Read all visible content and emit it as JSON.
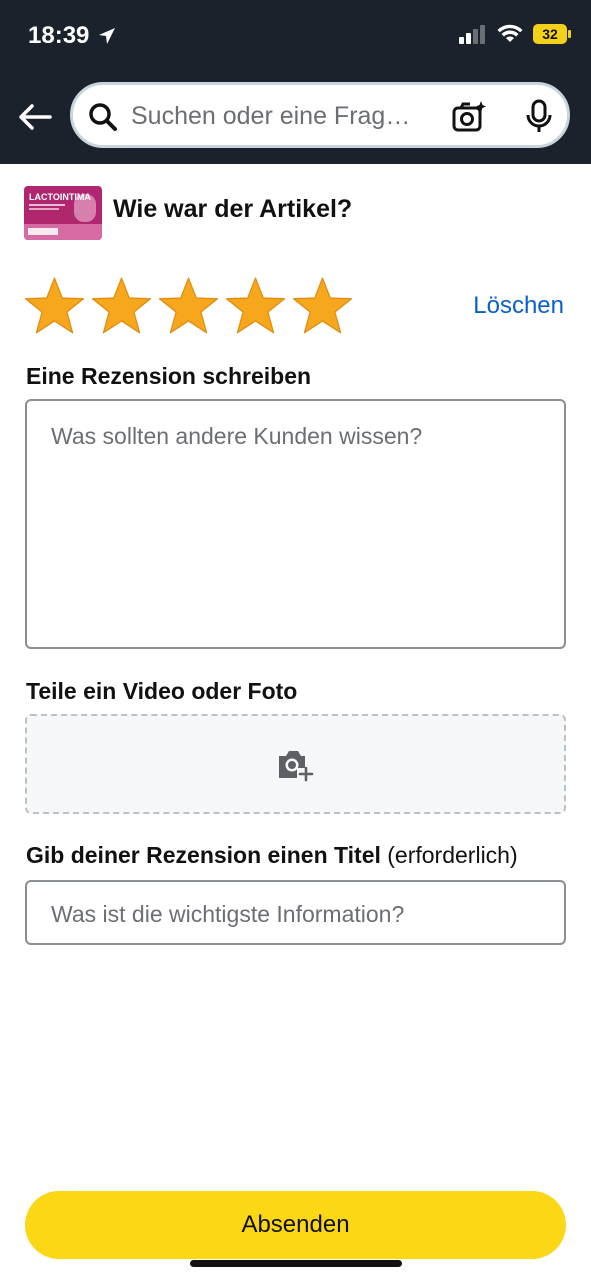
{
  "status_bar": {
    "time": "18:39",
    "battery": "32"
  },
  "search": {
    "placeholder": "Suchen oder eine Frag…"
  },
  "product": {
    "thumb_text": "LACTOINTIMA",
    "question": "Wie war der Artikel?"
  },
  "rating": {
    "value": 5,
    "max": 5,
    "delete_label": "Löschen"
  },
  "review": {
    "label": "Eine Rezension schreiben",
    "placeholder": "Was sollten andere Kunden wissen?"
  },
  "media": {
    "label": "Teile ein Video oder Foto"
  },
  "title": {
    "label_strong": "Gib deiner Rezension einen Titel",
    "label_suffix": " (erforderlich)",
    "placeholder": "Was ist die wichtigste Information?"
  },
  "submit": {
    "label": "Absenden"
  },
  "colors": {
    "header_bg": "#1c222c",
    "star": "#f7a71c",
    "link": "#0a60c9",
    "submit_bg": "#fcd716"
  }
}
